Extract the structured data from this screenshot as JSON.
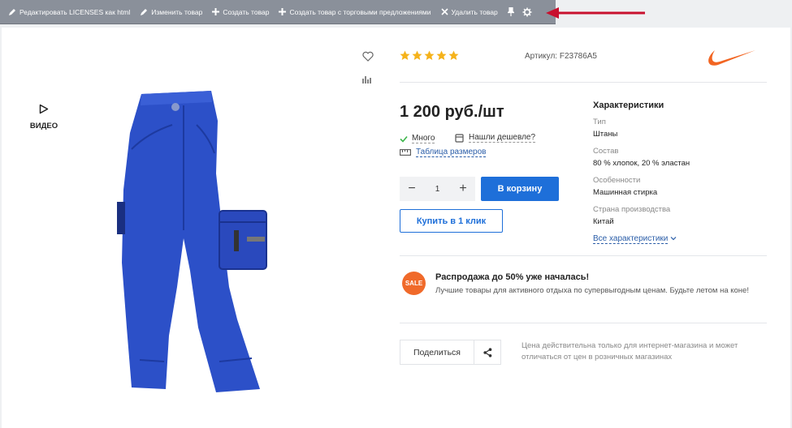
{
  "toolbar": {
    "edit_licenses": "Редактировать LICENSES как html",
    "edit_product": "Изменить товар",
    "create_product": "Создать товар",
    "create_product_offers": "Создать товар с торговыми предложениями",
    "delete_product": "Удалить товар"
  },
  "product": {
    "sku": "Артикул: F23786A5",
    "rating": 5,
    "price": "1 200 руб./шт",
    "stock": "Много",
    "cheaper": "Нашли дешевле?",
    "size_table": "Таблица размеров",
    "quantity": "1",
    "add_to_cart": "В корзину",
    "buy_one_click": "Купить в 1 клик",
    "video_label": "ВИДЕО"
  },
  "characteristics": {
    "title": "Характеристики",
    "items": [
      {
        "key": "Тип",
        "value": "Штаны"
      },
      {
        "key": "Состав",
        "value": "80 % хлопок, 20 % эластан"
      },
      {
        "key": "Особенности",
        "value": "Машинная стирка"
      },
      {
        "key": "Страна производства",
        "value": "Китай"
      }
    ],
    "all_link": "Все характеристики"
  },
  "promo": {
    "badge": "SALE",
    "title": "Распродажа до 50% уже началась!",
    "text": "Лучшие товары для активного отдыха по супервыгодным ценам. Будьте летом на коне!"
  },
  "share": {
    "label": "Поделиться",
    "note": "Цена действительна только для интернет-магазина и может отличаться от цен в розничных магазинах"
  },
  "colors": {
    "accent": "#1e6fd9",
    "stars": "#f5b21a",
    "sale": "#f06a2a",
    "brand": "#f26522",
    "toolbar": "#8a909a",
    "arrow": "#c8102e"
  }
}
